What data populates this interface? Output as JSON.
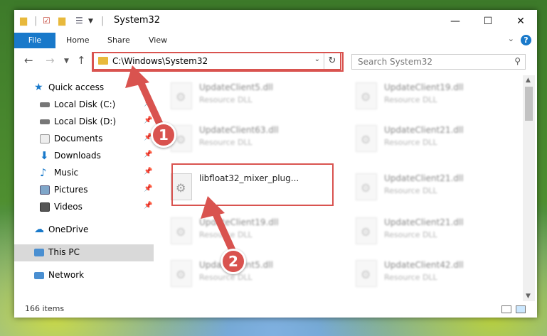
{
  "window": {
    "title": "System32",
    "minimize_glyph": "—",
    "maximize_glyph": "☐",
    "close_glyph": "✕"
  },
  "ribbon": {
    "tabs": [
      "File",
      "Home",
      "Share",
      "View"
    ],
    "help_glyph": "?"
  },
  "nav": {
    "address_path": "C:\\Windows\\System32",
    "search_placeholder": "Search System32"
  },
  "sidebar": {
    "items": [
      {
        "label": "Quick access",
        "icon": "star-icon"
      },
      {
        "label": "Local Disk (C:)",
        "icon": "drive-icon",
        "pinned": true
      },
      {
        "label": "Local Disk (D:)",
        "icon": "drive-icon",
        "pinned": true
      },
      {
        "label": "Documents",
        "icon": "documents-icon",
        "pinned": true
      },
      {
        "label": "Downloads",
        "icon": "download-icon",
        "pinned": true
      },
      {
        "label": "Music",
        "icon": "music-icon",
        "pinned": true
      },
      {
        "label": "Pictures",
        "icon": "pictures-icon",
        "pinned": true
      },
      {
        "label": "Videos",
        "icon": "videos-icon",
        "pinned": true
      },
      {
        "label": "OneDrive",
        "icon": "cloud-icon"
      },
      {
        "label": "This PC",
        "icon": "computer-icon",
        "selected": true
      },
      {
        "label": "Network",
        "icon": "network-icon"
      }
    ]
  },
  "files": {
    "left": [
      {
        "name": "UpdateClient5.dll",
        "type": "Resource DLL"
      },
      {
        "name": "UpdateClient63.dll",
        "type": "Resource DLL"
      },
      {
        "name": "libfloat32_mixer_plug...",
        "type": ""
      },
      {
        "name": "UpdateClient19.dll",
        "type": "Resource DLL"
      },
      {
        "name": "UpdateClient5.dll",
        "type": "Resource DLL"
      }
    ],
    "right": [
      {
        "name": "UpdateClient19.dll",
        "type": "Resource DLL"
      },
      {
        "name": "UpdateClient21.dll",
        "type": "Resource DLL"
      },
      {
        "name": "UpdateClient21.dll",
        "type": "Resource DLL"
      },
      {
        "name": "UpdateClient21.dll",
        "type": "Resource DLL"
      },
      {
        "name": "UpdateClient42.dll",
        "type": "Resource DLL"
      }
    ]
  },
  "status": {
    "item_count": "166 items"
  },
  "annotations": {
    "step1": "1",
    "step2": "2",
    "color": "#d9534f"
  }
}
